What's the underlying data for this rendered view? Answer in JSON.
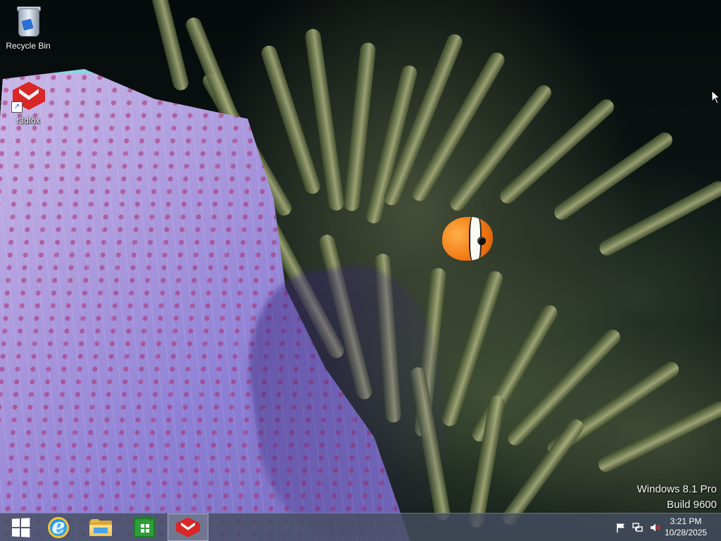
{
  "desktop": {
    "icons": [
      {
        "label": "Recycle Bin",
        "icon": "recycle-bin-icon"
      },
      {
        "label": "r3dfox",
        "icon": "r3dfox-icon"
      }
    ],
    "watermark": {
      "edition": "Windows 8.1 Pro",
      "build": "Build 9600"
    }
  },
  "taskbar": {
    "buttons": [
      {
        "icon": "windows-start-icon"
      },
      {
        "icon": "internet-explorer-icon"
      },
      {
        "icon": "file-explorer-icon"
      },
      {
        "icon": "store-icon"
      },
      {
        "icon": "r3dfox-icon",
        "active": true
      }
    ],
    "tray": {
      "icons": [
        "action-center-flag-icon",
        "network-icon",
        "volume-muted-icon"
      ],
      "time": "3:21 PM",
      "date": "10/28/2025"
    }
  },
  "colors": {
    "taskbar": "#464e60",
    "active_button": "#969cb9",
    "r3dfox_red": "#d92626"
  }
}
